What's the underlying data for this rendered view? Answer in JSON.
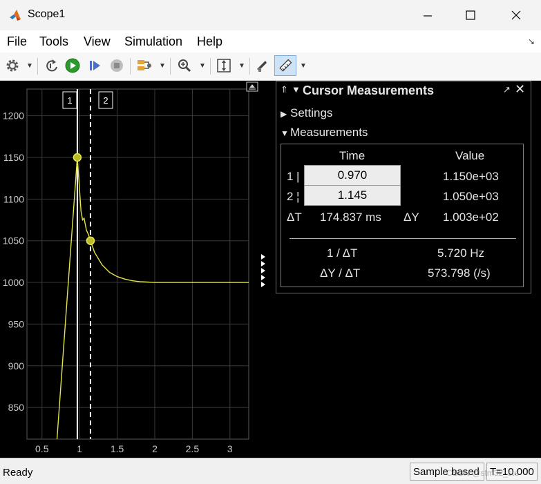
{
  "window": {
    "title": "Scope1",
    "controls": [
      "minimize",
      "maximize",
      "close"
    ]
  },
  "menu": {
    "items": [
      "File",
      "Tools",
      "View",
      "Simulation",
      "Help"
    ]
  },
  "toolbar": {
    "icons": [
      "gear-icon",
      "step-back-icon",
      "run-icon",
      "step-forward-icon",
      "stop-icon",
      "highlight-icon",
      "zoom-icon",
      "fit-icon",
      "cursor-style-icon",
      "measure-ruler-icon"
    ]
  },
  "plot": {
    "y_ticks": [
      "1200",
      "1150",
      "1100",
      "1050",
      "1000",
      "950",
      "900",
      "850"
    ],
    "x_ticks": [
      "0.5",
      "1",
      "1.5",
      "2",
      "2.5",
      "3"
    ],
    "cursor1_label": "1",
    "cursor2_label": "2",
    "colors": {
      "signal": "#e6e64c",
      "grid": "#3a3a3a",
      "axes_border": "#5a5a5a",
      "cursor": "#ffffff"
    }
  },
  "chart_data": {
    "type": "line",
    "xlim": [
      0.3,
      3.25
    ],
    "ylim": [
      812,
      1232
    ],
    "series": [
      {
        "color": "#e6e64c",
        "x": [
          0.7,
          0.97,
          1.02,
          1.04,
          1.06,
          1.09,
          1.12,
          1.145,
          1.2,
          1.3,
          1.4,
          1.5,
          1.6,
          1.7,
          1.8,
          1.9,
          2.0,
          2.2,
          2.4,
          2.6,
          2.8,
          3.0,
          3.25
        ],
        "y": [
          812,
          1150,
          1085,
          1075,
          1077,
          1063,
          1057,
          1050,
          1036,
          1021,
          1012,
          1007,
          1004,
          1002,
          1001,
          1000.5,
          1000,
          1000,
          1000,
          1000,
          1000,
          1000,
          1000
        ]
      }
    ],
    "cursors": [
      {
        "label": "1",
        "time": 0.97,
        "value": 1150
      },
      {
        "label": "2",
        "time": 1.145,
        "value": 1050
      }
    ],
    "grid": true
  },
  "measurements": {
    "title": "Cursor Measurements",
    "settings_label": "Settings",
    "measurements_label": "Measurements",
    "col_time": "Time",
    "col_value": "Value",
    "row1_label": "1",
    "row1_time": "0.970",
    "row1_value": "1.150e+03",
    "row2_label": "2",
    "row2_time": "1.145",
    "row2_value": "1.050e+03",
    "dt_label": "ΔT",
    "dt_value": "174.837 ms",
    "dy_label": "ΔY",
    "dy_value": "1.003e+02",
    "inv_dt_label": "1 / ΔT",
    "inv_dt_value": "5.720 Hz",
    "dydt_label": "ΔY / ΔT",
    "dydt_value": "573.798 (/s)"
  },
  "status": {
    "ready": "Ready",
    "sample_based": "Sample based",
    "time": "T=10.000",
    "watermark": "CSDN @stm32_ste"
  }
}
